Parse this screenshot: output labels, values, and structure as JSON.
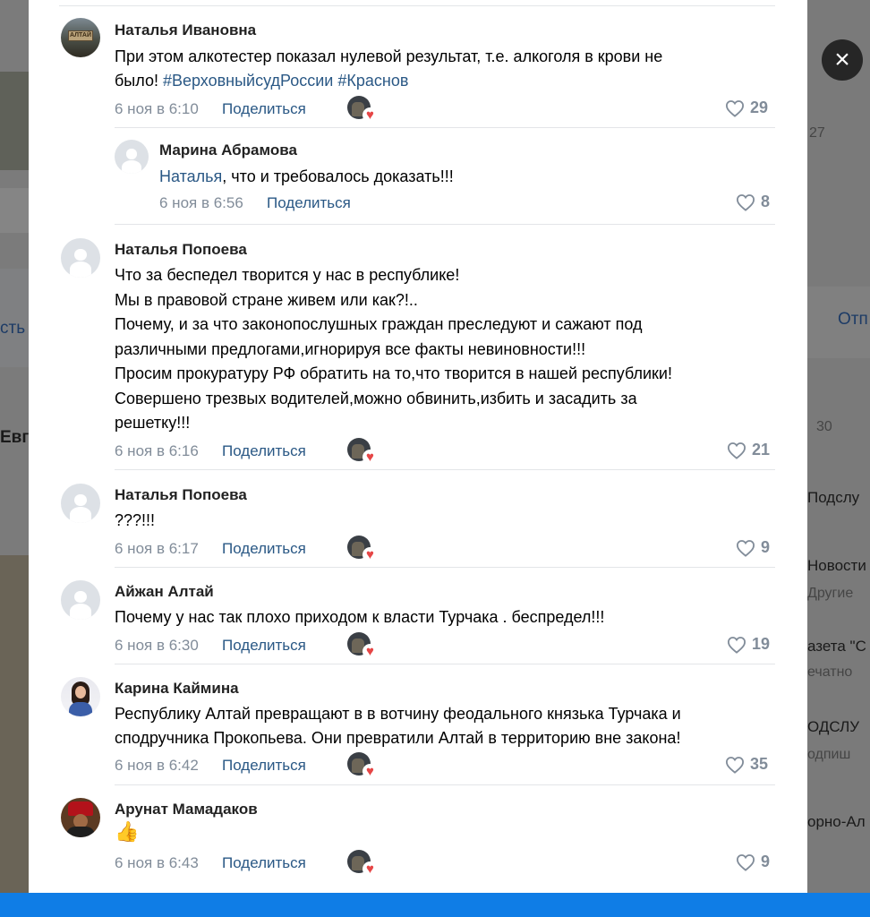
{
  "background": {
    "right_texts": [
      "27",
      "30",
      "Отп",
      "Подслу",
      "Новости",
      "Другие",
      "азета \"С",
      "ечатно",
      "ОДСЛУ",
      "одпиш",
      "орно-Ал"
    ],
    "left_texts": [
      "сть",
      "Евг"
    ]
  },
  "close_label": "×",
  "share_label": "Поделиться",
  "comments": [
    {
      "author": "Наталья Ивановна",
      "lines": [
        "При этом алкотестер показал нулевой результат, т.е. алкоголя в крови не"
      ],
      "line2_prefix": "было! ",
      "line2_links": [
        "#ВерховныйсудРоссии",
        "#Краснов"
      ],
      "date": "6 ноя в 6:10",
      "likes": "29"
    },
    {
      "author": "Марина Абрамова",
      "mention": "Наталья",
      "text": ", что и требовалось доказать!!!",
      "date": "6 ноя в 6:56",
      "likes": "8"
    },
    {
      "author": "Наталья Попоева",
      "lines": [
        "Что за беспедел творится у нас в республике!",
        "Мы в правовой стране живем или как?!..",
        "Почему, и за что законопослушных граждан преследуют и сажают под",
        "различными предлогами,игнорируя все факты невиновности!!!",
        "Просим прокуратуру РФ обратить на то,что творится в нашей республики!",
        "Совершено трезвых водителей,можно обвинить,избить и засадить за",
        "решетку!!!"
      ],
      "date": "6 ноя в 6:16",
      "likes": "21"
    },
    {
      "author": "Наталья Попоева",
      "lines": [
        "???!!!"
      ],
      "date": "6 ноя в 6:17",
      "likes": "9"
    },
    {
      "author": "Айжан Алтай",
      "lines": [
        "Почему у нас так плохо приходом к власти Турчака . беспредел!!!"
      ],
      "date": "6 ноя в 6:30",
      "likes": "19"
    },
    {
      "author": "Карина Каймина",
      "lines": [
        "Республику Алтай превращают в в вотчину феодального князька Турчака и",
        "сподручника Прокопьева. Они превратили Алтай в территорию вне закона!"
      ],
      "date": "6 ноя в 6:42",
      "likes": "35"
    },
    {
      "author": "Арунат Мамадаков",
      "emoji": "👍",
      "date": "6 ноя в 6:43",
      "likes": "9"
    }
  ]
}
